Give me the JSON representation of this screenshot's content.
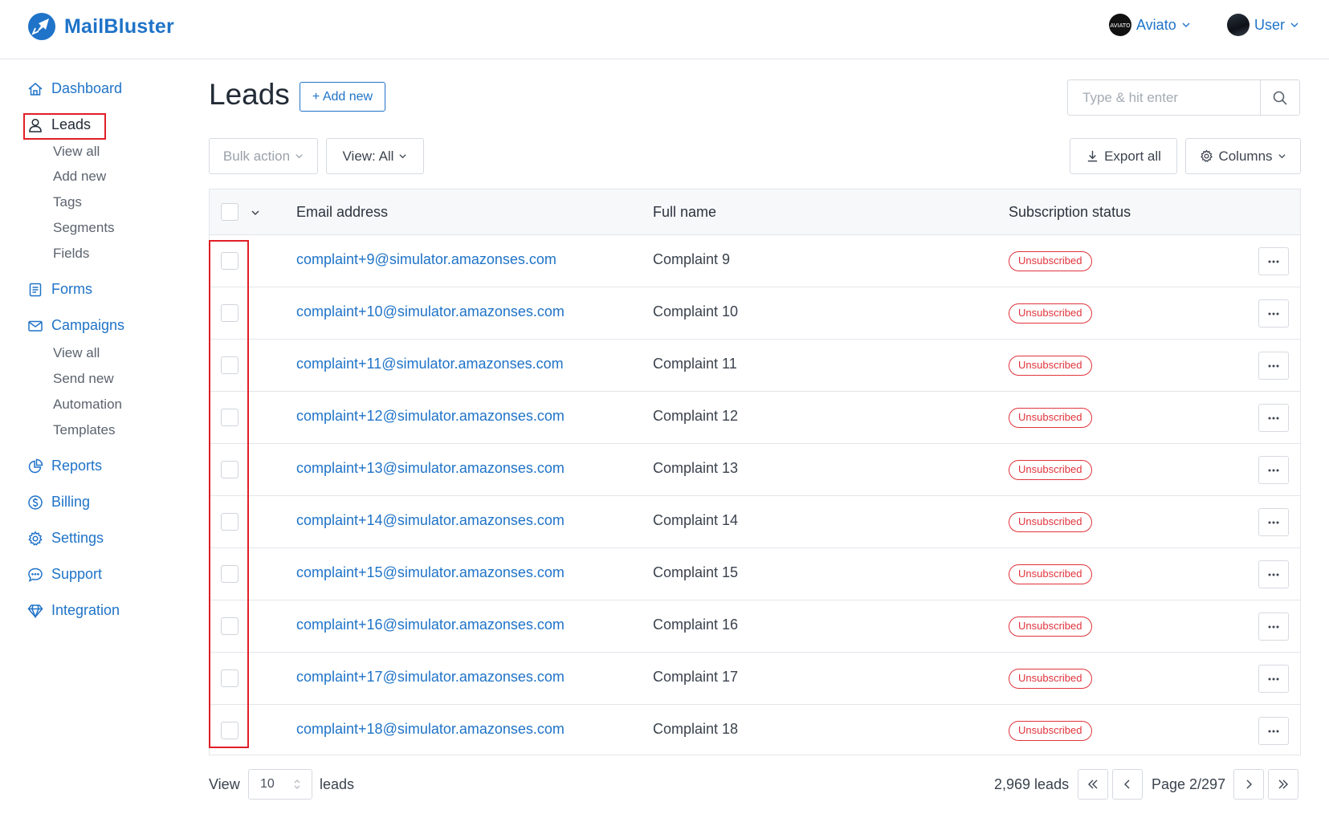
{
  "app": {
    "name": "MailBluster",
    "brand_color": "#1f73c8",
    "danger_color": "#e0343c"
  },
  "header": {
    "account_label": "Aviato",
    "user_label": "User"
  },
  "sidebar": {
    "items": [
      {
        "label": "Dashboard",
        "icon": "home-icon"
      },
      {
        "label": "Leads",
        "icon": "user-icon",
        "active": true
      },
      {
        "label": "Forms",
        "icon": "form-icon"
      },
      {
        "label": "Campaigns",
        "icon": "envelope-icon"
      },
      {
        "label": "Reports",
        "icon": "pie-chart-icon"
      },
      {
        "label": "Billing",
        "icon": "dollar-icon"
      },
      {
        "label": "Settings",
        "icon": "gear-icon"
      },
      {
        "label": "Support",
        "icon": "chat-icon"
      },
      {
        "label": "Integration",
        "icon": "diamond-icon"
      }
    ],
    "leads_sub": [
      "View all",
      "Add new",
      "Tags",
      "Segments",
      "Fields"
    ],
    "campaigns_sub": [
      "View all",
      "Send new",
      "Automation",
      "Templates"
    ]
  },
  "main": {
    "title": "Leads",
    "add_new_label": "+ Add new",
    "search_placeholder": "Type & hit enter",
    "bulk_action_label": "Bulk action",
    "view_label": "View: All",
    "export_label": "Export all",
    "columns_label": "Columns"
  },
  "table": {
    "columns": [
      "Email address",
      "Full name",
      "Subscription status"
    ],
    "rows": [
      {
        "email": "complaint+9@simulator.amazonses.com",
        "name": "Complaint 9",
        "status": "Unsubscribed"
      },
      {
        "email": "complaint+10@simulator.amazonses.com",
        "name": "Complaint 10",
        "status": "Unsubscribed"
      },
      {
        "email": "complaint+11@simulator.amazonses.com",
        "name": "Complaint 11",
        "status": "Unsubscribed"
      },
      {
        "email": "complaint+12@simulator.amazonses.com",
        "name": "Complaint 12",
        "status": "Unsubscribed"
      },
      {
        "email": "complaint+13@simulator.amazonses.com",
        "name": "Complaint 13",
        "status": "Unsubscribed"
      },
      {
        "email": "complaint+14@simulator.amazonses.com",
        "name": "Complaint 14",
        "status": "Unsubscribed"
      },
      {
        "email": "complaint+15@simulator.amazonses.com",
        "name": "Complaint 15",
        "status": "Unsubscribed"
      },
      {
        "email": "complaint+16@simulator.amazonses.com",
        "name": "Complaint 16",
        "status": "Unsubscribed"
      },
      {
        "email": "complaint+17@simulator.amazonses.com",
        "name": "Complaint 17",
        "status": "Unsubscribed"
      },
      {
        "email": "complaint+18@simulator.amazonses.com",
        "name": "Complaint 18",
        "status": "Unsubscribed"
      }
    ]
  },
  "footer": {
    "view_label": "View",
    "per_page": "10",
    "leads_label": "leads",
    "total_label": "2,969 leads",
    "page_label": "Page 2/297"
  }
}
